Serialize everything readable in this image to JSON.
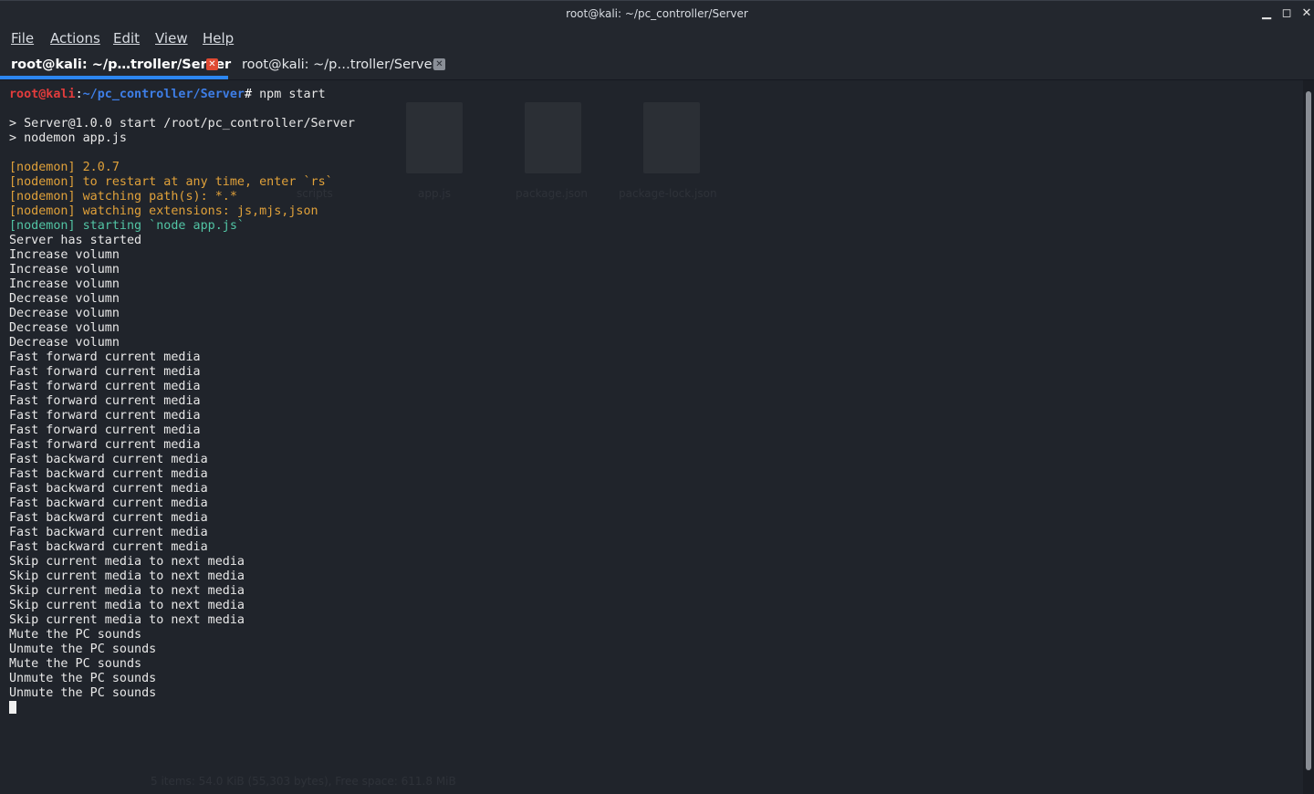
{
  "window": {
    "title": "root@kali: ~/pc_controller/Server",
    "controls": {
      "minimize": "▁",
      "maximize": "◻",
      "close": "✕"
    }
  },
  "menu": {
    "items": [
      {
        "label": "File"
      },
      {
        "label": "Actions"
      },
      {
        "label": "Edit"
      },
      {
        "label": "View"
      },
      {
        "label": "Help"
      }
    ]
  },
  "tabs": [
    {
      "label": "root@kali: ~/p…troller/Server",
      "active": true
    },
    {
      "label": "root@kali: ~/p…troller/Server",
      "active": false
    }
  ],
  "prompt": {
    "user": "root@kali",
    "colon": ":",
    "path": "~/pc_controller/Server",
    "hash": "# ",
    "command": "npm start"
  },
  "output": {
    "npm_lines": [
      "> Server@1.0.0 start /root/pc_controller/Server",
      "> nodemon app.js"
    ],
    "nodemon_yellow": [
      "[nodemon] 2.0.7",
      "[nodemon] to restart at any time, enter `rs`",
      "[nodemon] watching path(s): *.*",
      "[nodemon] watching extensions: js,mjs,json"
    ],
    "nodemon_green": "[nodemon] starting `node app.js`",
    "log_lines": [
      "Server has started",
      "Increase volumn",
      "Increase volumn",
      "Increase volumn",
      "Decrease volumn",
      "Decrease volumn",
      "Decrease volumn",
      "Decrease volumn",
      "Fast forward current media",
      "Fast forward current media",
      "Fast forward current media",
      "Fast forward current media",
      "Fast forward current media",
      "Fast forward current media",
      "Fast forward current media",
      "Fast backward current media",
      "Fast backward current media",
      "Fast backward current media",
      "Fast backward current media",
      "Fast backward current media",
      "Fast backward current media",
      "Fast backward current media",
      "Skip current media to next media",
      "Skip current media to next media",
      "Skip current media to next media",
      "Skip current media to next media",
      "Skip current media to next media",
      "Mute the PC sounds",
      "Unmute the PC sounds",
      "Mute the PC sounds",
      "Unmute the PC sounds",
      "Unmute the PC sounds"
    ]
  },
  "background_desktop": {
    "files": [
      "scripts",
      "app.js",
      "package.json",
      "package-lock.json"
    ],
    "status": "5 items: 54.0 KiB (55,303 bytes), Free space: 611.8 MiB"
  },
  "colors": {
    "accent": "#2c86f0",
    "prompt_user": "#e23c3c",
    "prompt_path": "#3e7ee6",
    "nodemon_info": "#e0a13a",
    "nodemon_start": "#52c4a4"
  }
}
